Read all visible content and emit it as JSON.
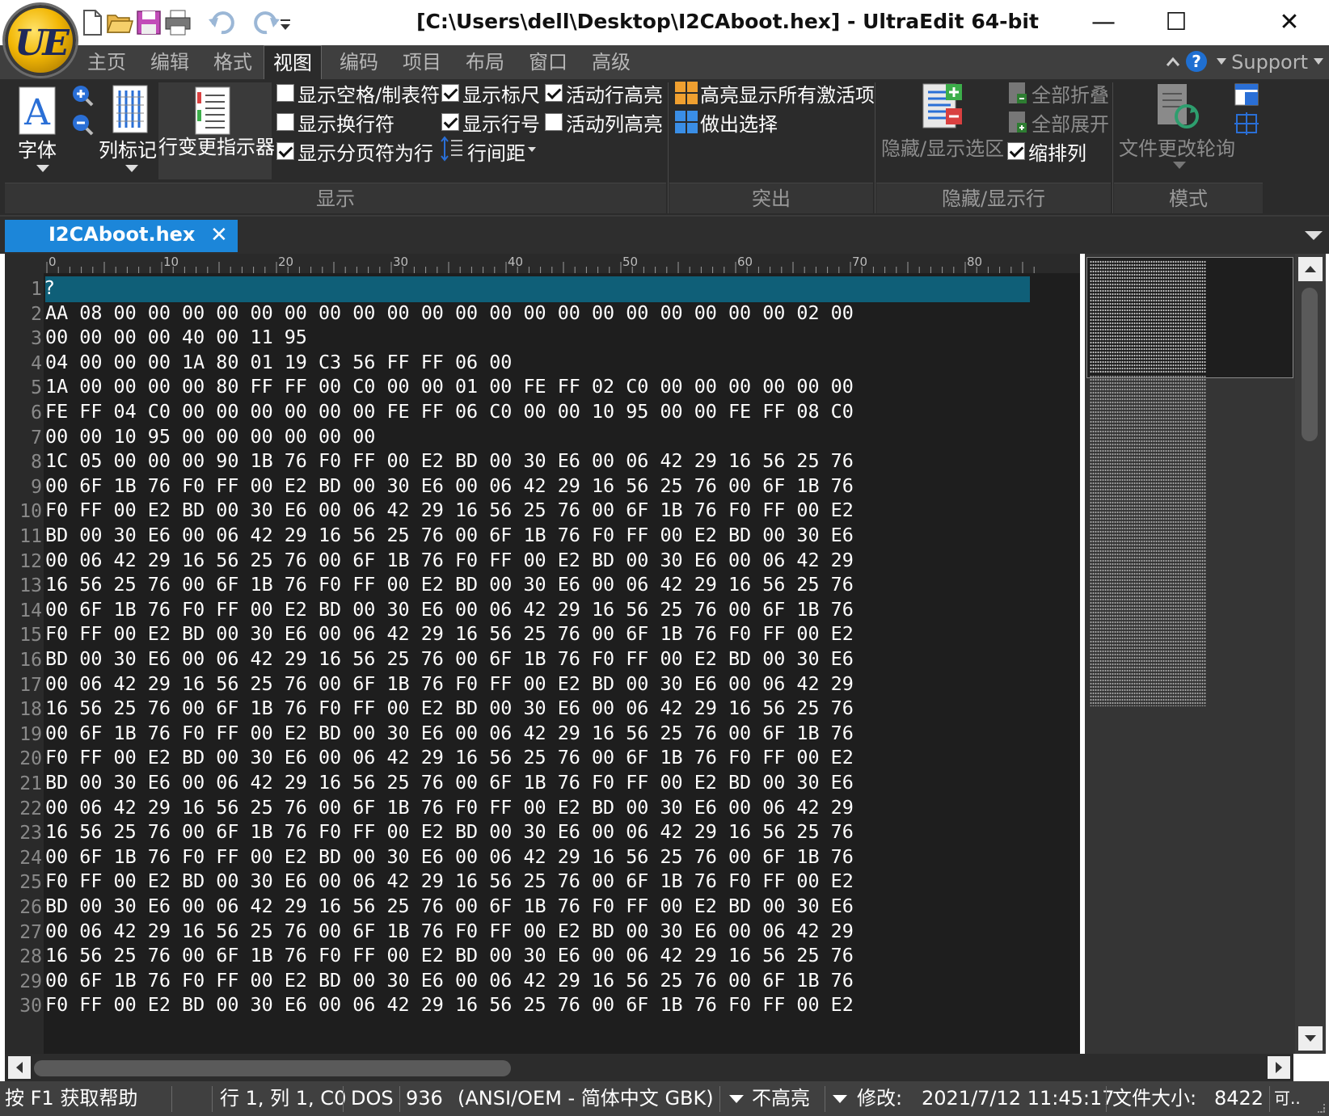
{
  "window": {
    "title": "[C:\\Users\\dell\\Desktop\\I2CAboot.hex] - UltraEdit 64-bit",
    "logo_text": "UE",
    "minimize_icon": "—",
    "maximize_icon": "☐",
    "close_icon": "✕"
  },
  "menu_tabs": [
    "主页",
    "编辑",
    "格式",
    "视图",
    "编码",
    "项目",
    "布局",
    "窗口",
    "高级"
  ],
  "active_menu_tab": "视图",
  "support_label": "Support",
  "ribbon": {
    "font_label": "字体",
    "column_marker_label": "列标记",
    "line_change_label": "行变更指示器",
    "show_spaces_tabs": "显示空格/制表符",
    "show_line_breaks": "显示换行符",
    "show_page_breaks": "显示分页符为行",
    "show_ruler": "显示标尺",
    "show_line_numbers": "显示行号",
    "line_spacing": "行间距",
    "active_line_highlight": "活动行高亮",
    "active_column_highlight": "活动列高亮",
    "highlight_all_active": "高亮显示所有激活项",
    "make_selection": "做出选择",
    "hide_show_selection": "隐藏/显示选区",
    "collapse_all": "全部折叠",
    "expand_all": "全部展开",
    "indent_columns": "缩排列",
    "file_change_polling": "文件更改轮询",
    "groups": {
      "display": "显示",
      "highlight": "突出",
      "hide_show_lines": "隐藏/显示行",
      "mode": "模式"
    }
  },
  "checkboxes": {
    "show_spaces_tabs": false,
    "show_line_breaks": false,
    "show_page_breaks": true,
    "show_ruler": true,
    "show_line_numbers": true,
    "active_line_highlight": true,
    "active_column_highlight": false,
    "indent_columns": true
  },
  "document_tab": {
    "name": "I2CAboot.hex",
    "close": "✕"
  },
  "ruler_labels": [
    "0",
    "10",
    "20",
    "30",
    "40",
    "50",
    "60",
    "70",
    "80"
  ],
  "editor": {
    "lines": [
      {
        "n": "1",
        "text": "?"
      },
      {
        "n": "2",
        "text": "AA 08 00 00 00 00 00 00 00 00 00 00 00 00 00 00 00 00 00 00 00 00 02 00"
      },
      {
        "n": "3",
        "text": "00 00 00 00 40 00 11 95"
      },
      {
        "n": "4",
        "text": "04 00 00 00 1A 80 01 19 C3 56 FF FF 06 00"
      },
      {
        "n": "5",
        "text": "1A 00 00 00 00 80 FF FF 00 C0 00 00 01 00 FE FF 02 C0 00 00 00 00 00 00"
      },
      {
        "n": "6",
        "text": "FE FF 04 C0 00 00 00 00 00 00 FE FF 06 C0 00 00 10 95 00 00 FE FF 08 C0"
      },
      {
        "n": "7",
        "text": "00 00 10 95 00 00 00 00 00 00"
      },
      {
        "n": "8",
        "text": "1C 05 00 00 00 90 1B 76 F0 FF 00 E2 BD 00 30 E6 00 06 42 29 16 56 25 76"
      },
      {
        "n": "9",
        "text": "00 6F 1B 76 F0 FF 00 E2 BD 00 30 E6 00 06 42 29 16 56 25 76 00 6F 1B 76"
      },
      {
        "n": "10",
        "text": "F0 FF 00 E2 BD 00 30 E6 00 06 42 29 16 56 25 76 00 6F 1B 76 F0 FF 00 E2"
      },
      {
        "n": "11",
        "text": "BD 00 30 E6 00 06 42 29 16 56 25 76 00 6F 1B 76 F0 FF 00 E2 BD 00 30 E6"
      },
      {
        "n": "12",
        "text": "00 06 42 29 16 56 25 76 00 6F 1B 76 F0 FF 00 E2 BD 00 30 E6 00 06 42 29"
      },
      {
        "n": "13",
        "text": "16 56 25 76 00 6F 1B 76 F0 FF 00 E2 BD 00 30 E6 00 06 42 29 16 56 25 76"
      },
      {
        "n": "14",
        "text": "00 6F 1B 76 F0 FF 00 E2 BD 00 30 E6 00 06 42 29 16 56 25 76 00 6F 1B 76"
      },
      {
        "n": "15",
        "text": "F0 FF 00 E2 BD 00 30 E6 00 06 42 29 16 56 25 76 00 6F 1B 76 F0 FF 00 E2"
      },
      {
        "n": "16",
        "text": "BD 00 30 E6 00 06 42 29 16 56 25 76 00 6F 1B 76 F0 FF 00 E2 BD 00 30 E6"
      },
      {
        "n": "17",
        "text": "00 06 42 29 16 56 25 76 00 6F 1B 76 F0 FF 00 E2 BD 00 30 E6 00 06 42 29"
      },
      {
        "n": "18",
        "text": "16 56 25 76 00 6F 1B 76 F0 FF 00 E2 BD 00 30 E6 00 06 42 29 16 56 25 76"
      },
      {
        "n": "19",
        "text": "00 6F 1B 76 F0 FF 00 E2 BD 00 30 E6 00 06 42 29 16 56 25 76 00 6F 1B 76"
      },
      {
        "n": "20",
        "text": "F0 FF 00 E2 BD 00 30 E6 00 06 42 29 16 56 25 76 00 6F 1B 76 F0 FF 00 E2"
      },
      {
        "n": "21",
        "text": "BD 00 30 E6 00 06 42 29 16 56 25 76 00 6F 1B 76 F0 FF 00 E2 BD 00 30 E6"
      },
      {
        "n": "22",
        "text": "00 06 42 29 16 56 25 76 00 6F 1B 76 F0 FF 00 E2 BD 00 30 E6 00 06 42 29"
      },
      {
        "n": "23",
        "text": "16 56 25 76 00 6F 1B 76 F0 FF 00 E2 BD 00 30 E6 00 06 42 29 16 56 25 76"
      },
      {
        "n": "24",
        "text": "00 6F 1B 76 F0 FF 00 E2 BD 00 30 E6 00 06 42 29 16 56 25 76 00 6F 1B 76"
      },
      {
        "n": "25",
        "text": "F0 FF 00 E2 BD 00 30 E6 00 06 42 29 16 56 25 76 00 6F 1B 76 F0 FF 00 E2"
      },
      {
        "n": "26",
        "text": "BD 00 30 E6 00 06 42 29 16 56 25 76 00 6F 1B 76 F0 FF 00 E2 BD 00 30 E6"
      },
      {
        "n": "27",
        "text": "00 06 42 29 16 56 25 76 00 6F 1B 76 F0 FF 00 E2 BD 00 30 E6 00 06 42 29"
      },
      {
        "n": "28",
        "text": "16 56 25 76 00 6F 1B 76 F0 FF 00 E2 BD 00 30 E6 00 06 42 29 16 56 25 76"
      },
      {
        "n": "29",
        "text": "00 6F 1B 76 F0 FF 00 E2 BD 00 30 E6 00 06 42 29 16 56 25 76 00 6F 1B 76"
      },
      {
        "n": "30",
        "text": "F0 FF 00 E2 BD 00 30 E6 00 06 42 29 16 56 25 76 00 6F 1B 76 F0 FF 00 E2"
      }
    ]
  },
  "status": {
    "help": "按 F1 获取帮助",
    "position": "行 1, 列 1, C0",
    "line_ending": "DOS",
    "codepage": "936",
    "encoding": "(ANSI/OEM - 简体中文 GBK)",
    "highlight": "不高亮",
    "modified_label": "修改:",
    "modified_value": "2021/7/12 11:45:17",
    "filesize_label": "文件大小:",
    "filesize_value": "8422",
    "trailing": "可.."
  },
  "colors": {
    "accent_tab": "#1c86d9",
    "active_line": "#0f5f78",
    "editor_bg": "#1e1e1e"
  }
}
